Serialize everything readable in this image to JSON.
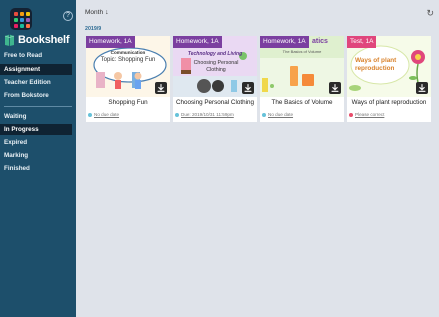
{
  "header": {
    "sort_label": "Month",
    "sort_direction_icon": "arrow-down-icon",
    "refresh_icon": "refresh-icon"
  },
  "sidebar": {
    "help_symbol": "?",
    "brand": "Bookshelf",
    "top_items": [
      {
        "label": "Free to Read",
        "active": false
      },
      {
        "label": "Assignment",
        "active": true
      },
      {
        "label": "Teacher Edition",
        "active": false
      },
      {
        "label": "From Bokstore",
        "active": false
      }
    ],
    "status_items": [
      {
        "label": "Waiting",
        "active": false
      },
      {
        "label": "In Progress",
        "active": true
      },
      {
        "label": "Expired",
        "active": false
      },
      {
        "label": "Marking",
        "active": false
      },
      {
        "label": "Finished",
        "active": false
      }
    ],
    "apps_icon_colors": [
      "#e84c3d",
      "#f39c12",
      "#f1c40f",
      "#2ecc71",
      "#3498db",
      "#9b59b6",
      "#e91e63",
      "#1abc9c",
      "#ff7043"
    ]
  },
  "group": {
    "label": "2019/9"
  },
  "cards": [
    {
      "tag": "Homework, 1A",
      "tag_color": "#7b3fa0",
      "title": "Shopping Fun",
      "status_dot_color": "#66c2d9",
      "due": "No due date",
      "cover_heading": "Communication",
      "cover_subheading": "Topic: Shopping Fun"
    },
    {
      "tag": "Homework, 1A",
      "tag_color": "#7b3fa0",
      "title": "Choosing Personal Clothing",
      "status_dot_color": "#66c2d9",
      "due": "Due: 2019/10/31 11:59pm",
      "cover_heading": "Technology and Living",
      "cover_subheading": "Choosing Personal Clothing"
    },
    {
      "tag": "Homework, 1A",
      "tag_color": "#7b3fa0",
      "title": "The Basics of Volume",
      "status_dot_color": "#66c2d9",
      "due": "No due date",
      "cover_heading": "atics",
      "cover_subheading": "The Basics of Volume"
    },
    {
      "tag": "Test, 1A",
      "tag_color": "#e0467c",
      "title": "Ways of plant reproduction",
      "status_dot_color": "#e84c6b",
      "due": "Please correct",
      "cover_heading": "Ways of plant reproduction",
      "cover_subheading": ""
    }
  ]
}
